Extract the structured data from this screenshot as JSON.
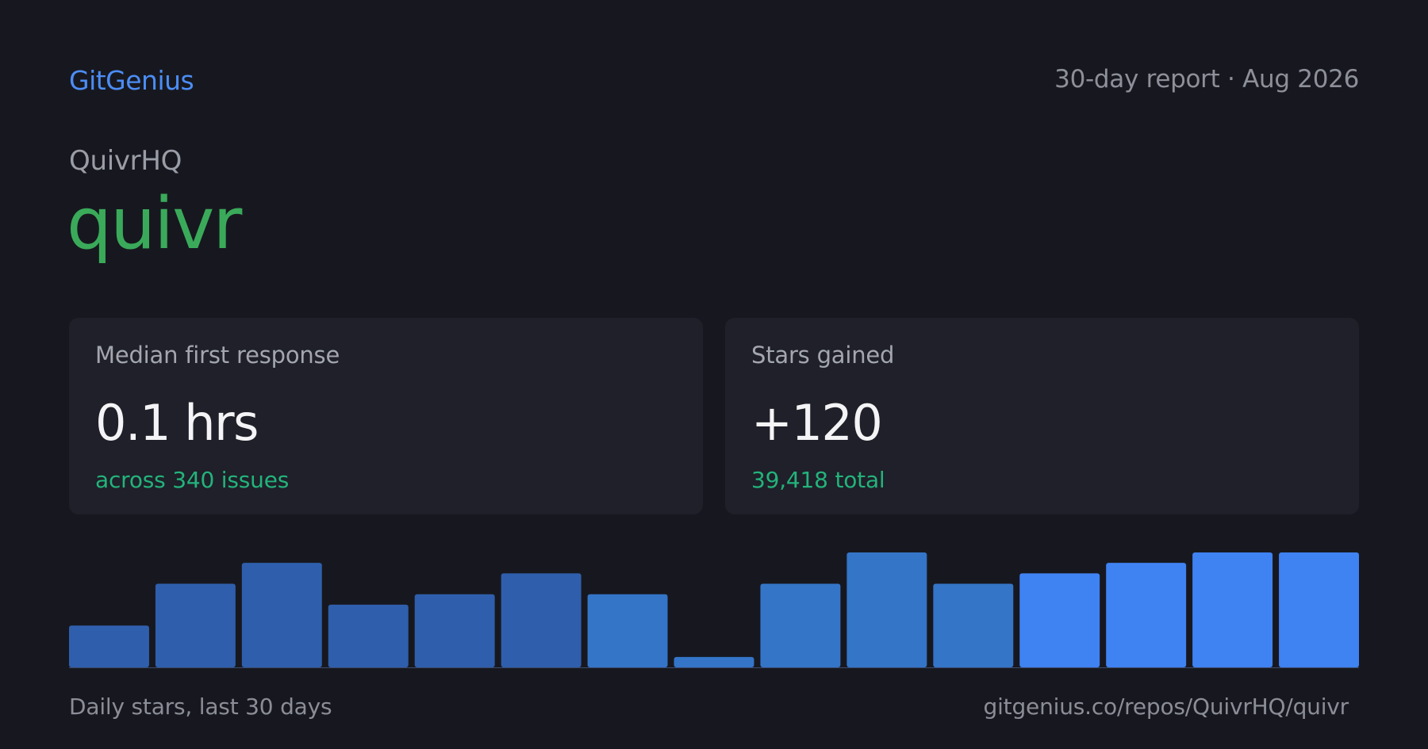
{
  "header": {
    "brand": "GitGenius",
    "report_meta": "30-day report · Aug 2026"
  },
  "repo": {
    "owner": "QuivrHQ",
    "name": "quivr"
  },
  "cards": [
    {
      "label": "Median first response",
      "value": "0.1 hrs",
      "sub": "across 340 issues"
    },
    {
      "label": "Stars gained",
      "value": "+120",
      "sub": "39,418 total"
    }
  ],
  "chart_data": {
    "type": "bar",
    "values": [
      4,
      8,
      10,
      6,
      7,
      9,
      7,
      1,
      8,
      11,
      8,
      9,
      10,
      11,
      11
    ],
    "colors": [
      "#2f5fac",
      "#2f5fac",
      "#2f5fac",
      "#2f5fac",
      "#2f5fac",
      "#2f5fac",
      "#3475c8",
      "#3475c8",
      "#3475c8",
      "#3475c8",
      "#3475c8",
      "#3f82f2",
      "#3f82f2",
      "#3f82f2",
      "#3f82f2"
    ],
    "ylim": [
      0,
      11
    ],
    "caption": "Daily stars, last 30 days",
    "url": "gitgenius.co/repos/QuivrHQ/quivr"
  }
}
